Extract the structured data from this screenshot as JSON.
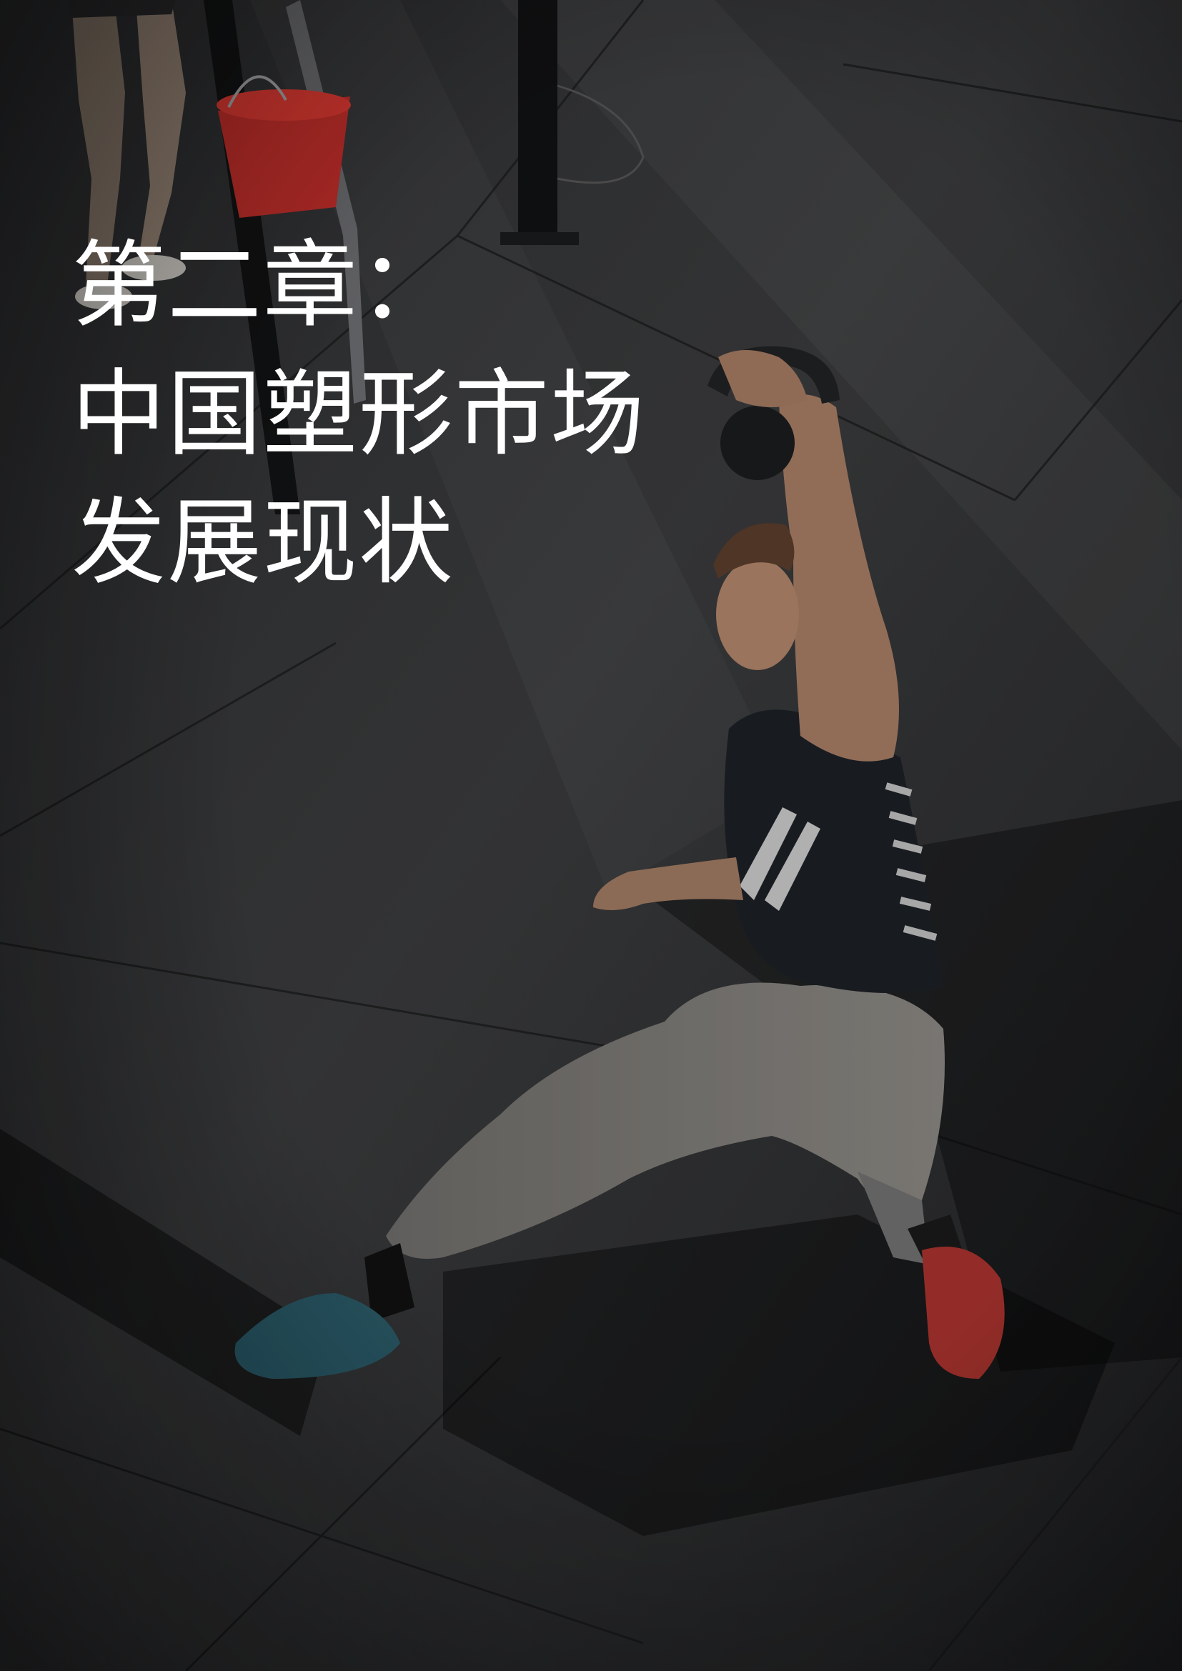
{
  "chapter": {
    "lines": [
      "第二章：",
      "中国塑形市场",
      "发展现状"
    ]
  },
  "colors": {
    "overlay": "#000000",
    "title_text": "#ffffff",
    "floor": "#343537"
  }
}
